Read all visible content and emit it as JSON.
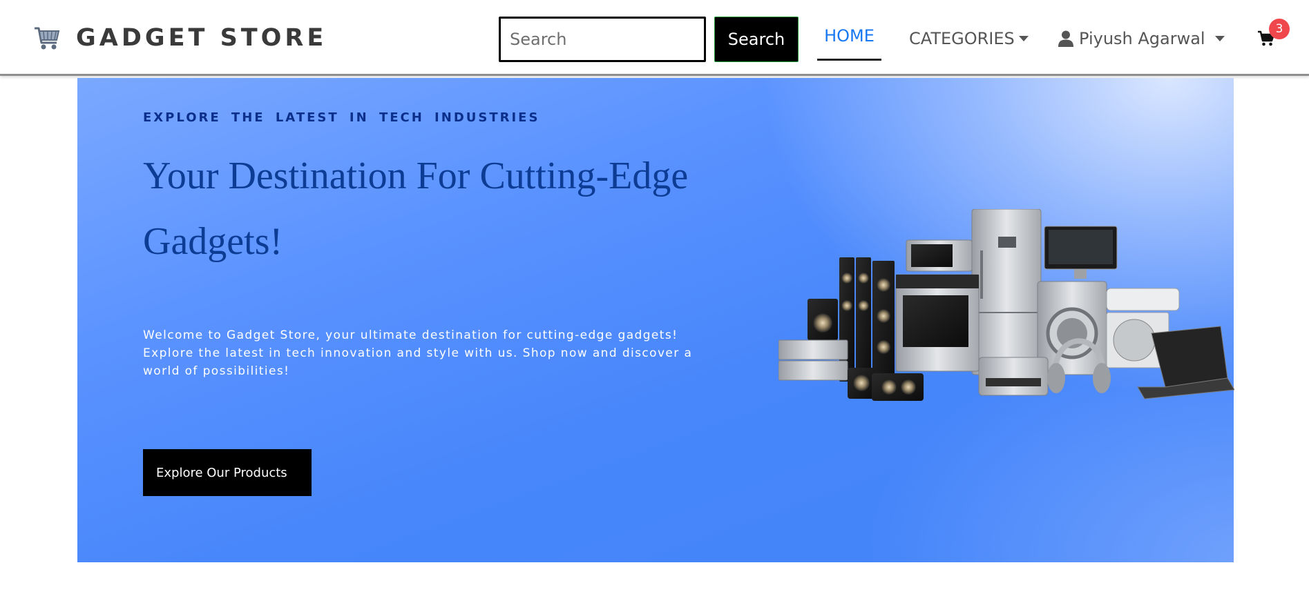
{
  "navbar": {
    "brand": {
      "icon": "shopping-cart-icon",
      "text": "GADGET STORE"
    },
    "search": {
      "placeholder": "Search",
      "value": "",
      "button_label": "Search"
    },
    "links": {
      "home": "HOME",
      "categories": "CATEGORIES"
    },
    "user": {
      "icon": "user-icon",
      "name": "Piyush Agarwal"
    },
    "cart": {
      "icon": "cart-icon",
      "count": "3"
    }
  },
  "hero": {
    "eyebrow": "EXPLORE THE LATEST IN TECH INDUSTRIES",
    "title": "Your Destination For Cutting-Edge Gadgets!",
    "description": "Welcome to Gadget Store, your ultimate destination for cutting-edge gadgets! Explore the latest in tech innovation and style with us. Shop now and discover a world of possibilities!",
    "cta_label": "Explore Our Products",
    "image": "appliances-collage-image"
  },
  "colors": {
    "accent": "#1877f2",
    "hero_bg": "#4786fb",
    "heading": "#0d3c95",
    "badge": "#f0474d",
    "button_bg": "#000000"
  }
}
